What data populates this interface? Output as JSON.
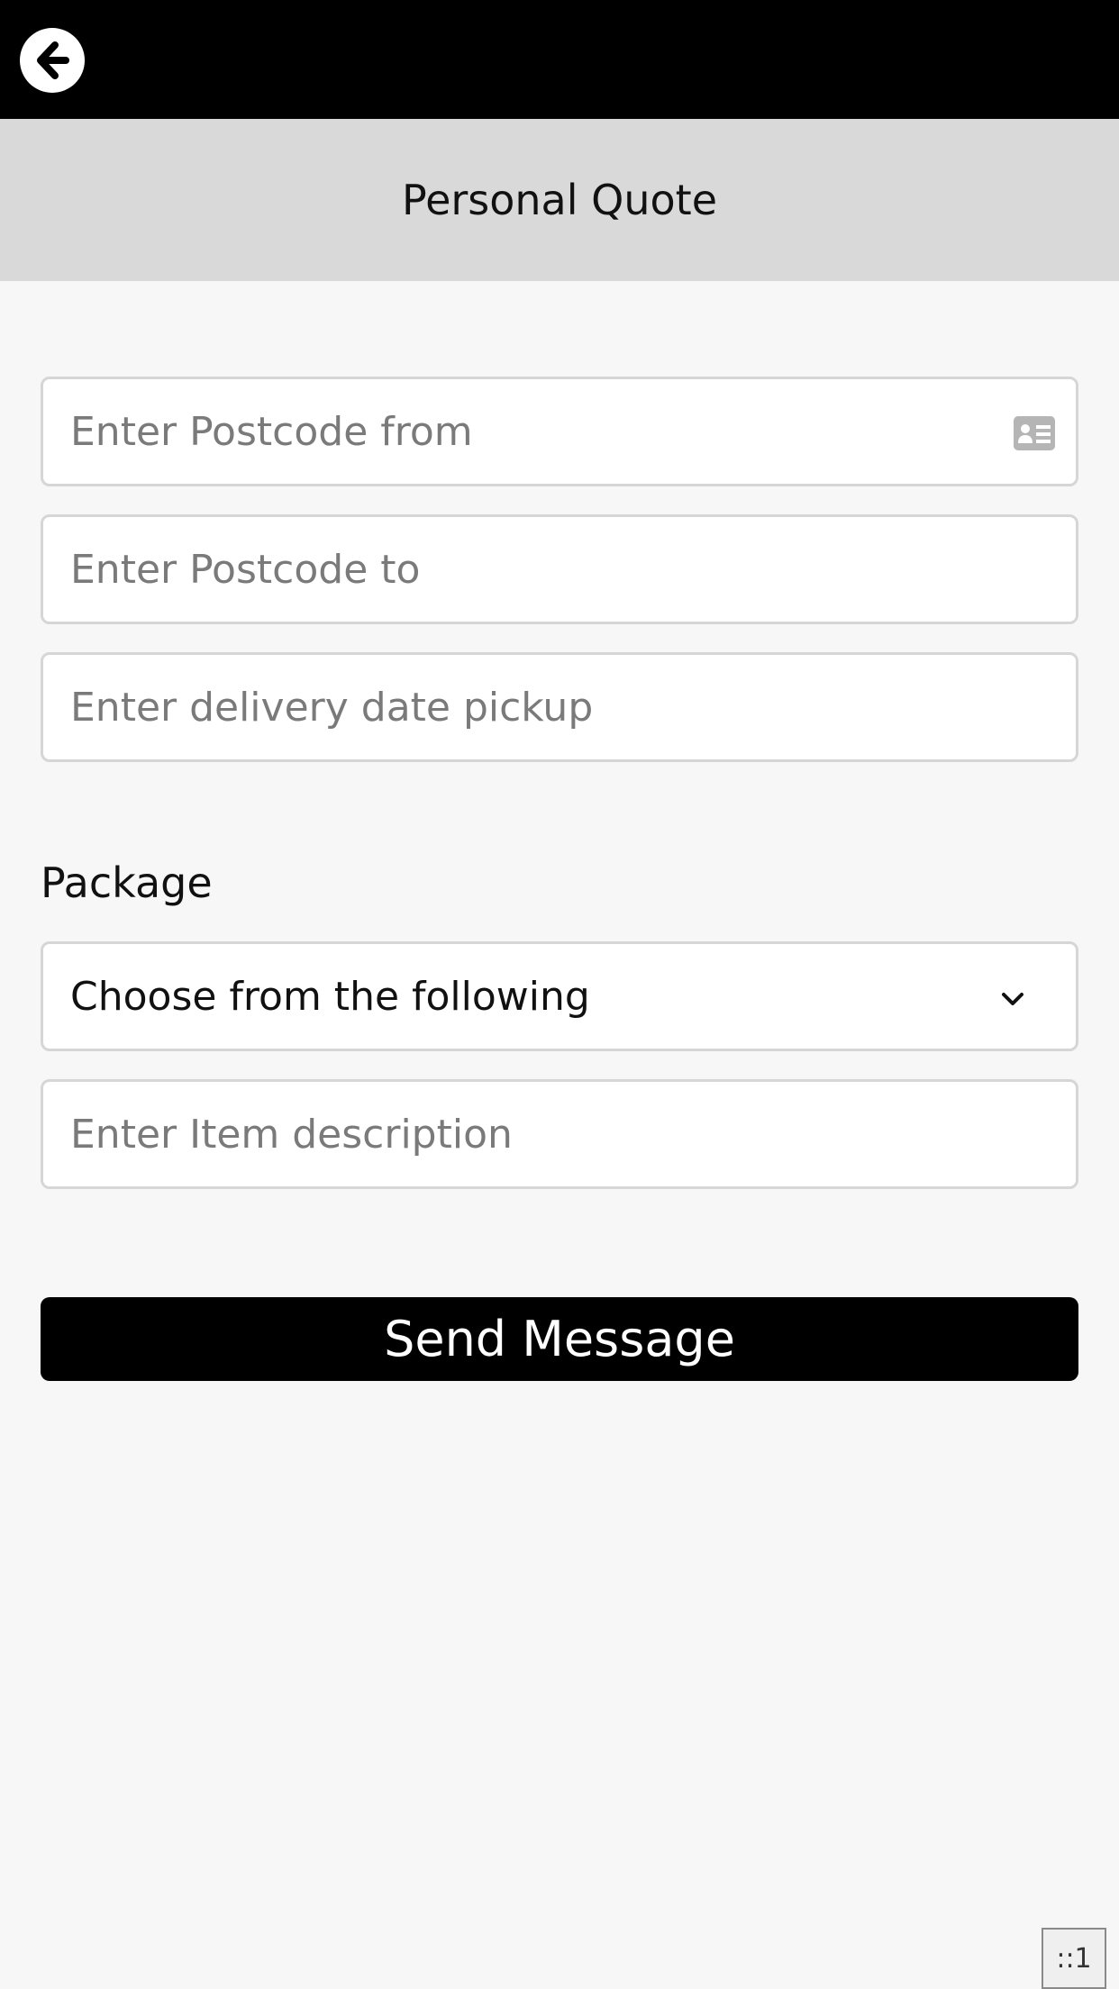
{
  "header": {
    "back_icon": "arrow-left-circle-icon",
    "title": "Personal Quote"
  },
  "form": {
    "postcode_from": {
      "value": "",
      "placeholder": "Enter Postcode from",
      "icon": "contact-card-icon"
    },
    "postcode_to": {
      "value": "",
      "placeholder": "Enter Postcode to"
    },
    "delivery_date": {
      "value": "",
      "placeholder": "Enter delivery date pickup"
    },
    "package_label": "Package",
    "package_select": {
      "selected": "Choose from the following",
      "icon": "chevron-down-icon"
    },
    "item_description": {
      "value": "",
      "placeholder": "Enter Item description"
    },
    "submit_label": "Send Message"
  },
  "footer": {
    "badge_text": "::1"
  },
  "colors": {
    "topbar": "#000000",
    "title_bar": "#d9d9d9",
    "background": "#f7f7f7",
    "button": "#000000",
    "button_text": "#ffffff",
    "border": "#d6d6d6"
  }
}
